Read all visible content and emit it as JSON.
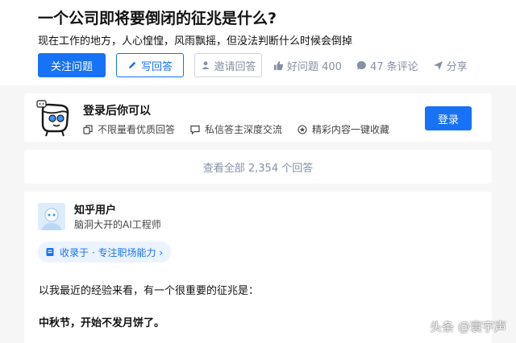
{
  "question": {
    "title": "一个公司即将要倒闭的征兆是什么?",
    "description": "现在工作的地方，人心惶惶，风雨飘摇，但没法判断什么时候会倒掉"
  },
  "actions": {
    "follow_label": "关注问题",
    "write_label": "写回答",
    "invite_label": "邀请回答",
    "good_question_label": "好问题 400",
    "comments_label": "47 条评论",
    "share_label": "分享"
  },
  "login_card": {
    "title": "登录后你可以",
    "perks": [
      "不限量看优质回答",
      "私信答主深度交流",
      "精彩内容一键收藏"
    ],
    "button_label": "登录"
  },
  "view_all": {
    "label": "查看全部 2,354 个回答"
  },
  "answer": {
    "author_name": "知乎用户",
    "author_bio": "脑洞大开的AI工程师",
    "collection_label": "收录于 · 专注职场能力 ›",
    "paragraph_1": "以我最近的经验来看，有一个很重要的征兆是：",
    "paragraph_2": "中秋节，开始不发月饼了。"
  },
  "watermark": {
    "text": "头条 @寰宇声"
  },
  "colors": {
    "brand_blue": "#1772f6",
    "muted_gray": "#8590a6",
    "page_bg": "#f6f6f6"
  },
  "icons": [
    "pencil-icon",
    "invite-person-icon",
    "thumb-up-icon",
    "comment-icon",
    "share-icon",
    "copy-icon",
    "message-icon",
    "star-icon",
    "collection-icon",
    "mascot-icon"
  ]
}
